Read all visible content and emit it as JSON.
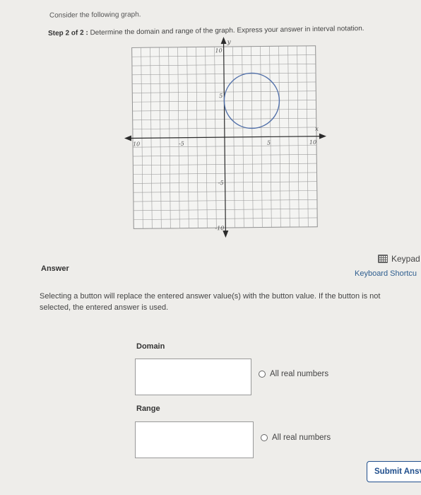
{
  "question": {
    "intro": "Consider the following graph.",
    "step_label": "Step 2 of 2 :",
    "step_text": "Determine the domain and range of the graph. Express your answer in interval notation."
  },
  "graph": {
    "x_label": "x",
    "y_label": "y",
    "xlim": [
      -10,
      10
    ],
    "ylim": [
      -10,
      10
    ],
    "grid": true,
    "x_tick_labels": [
      {
        "value": -10,
        "text": "10"
      },
      {
        "value": -5,
        "text": "-5"
      },
      {
        "value": 5,
        "text": "5"
      },
      {
        "value": 10,
        "text": "10"
      }
    ],
    "y_tick_labels": [
      {
        "value": 10,
        "text": "10"
      },
      {
        "value": 5,
        "text": "5"
      },
      {
        "value": -5,
        "text": "-5"
      },
      {
        "value": -10,
        "text": "-10"
      }
    ],
    "circle": {
      "center": [
        3,
        4
      ],
      "radius": 3
    },
    "line_color": "#4f6ea8"
  },
  "answer": {
    "label": "Answer",
    "keypad_label": "Keypad",
    "shortcuts_label": "Keyboard Shortcu",
    "note": "Selecting a button will replace the entered answer value(s) with the button value. If the button is not selected, the entered answer is used.",
    "domain_label": "Domain",
    "domain_value": "",
    "domain_option": "All real numbers",
    "range_label": "Range",
    "range_value": "",
    "range_option": "All real numbers",
    "submit_label": "Submit Ansv"
  }
}
